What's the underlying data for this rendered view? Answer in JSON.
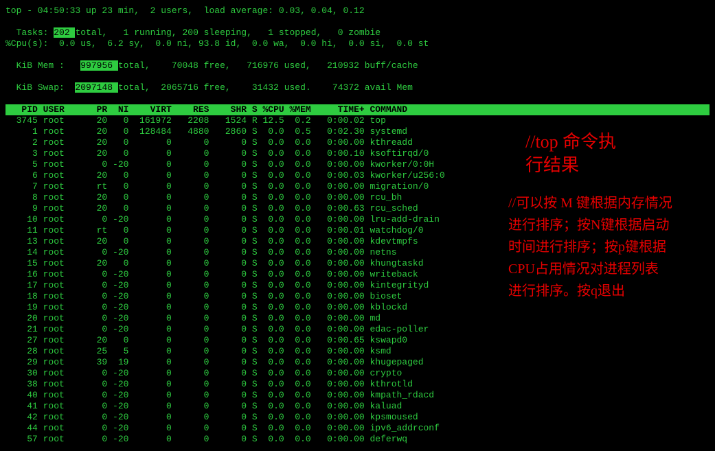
{
  "header": {
    "line1": "top - 04:50:33 up 23 min,  2 users,  load average: 0.03, 0.04, 0.12",
    "line2_pre": "Tasks: ",
    "line2_total": "202 ",
    "line2_post": "total,   1 running, 200 sleeping,   1 stopped,   0 zombie",
    "line3": "%Cpu(s):  0.0 us,  6.2 sy,  0.0 ni, 93.8 id,  0.0 wa,  0.0 hi,  0.0 si,  0.0 st",
    "line4_pre": "KiB Mem :   ",
    "line4_total": "997956 ",
    "line4_post": "total,    70048 free,   716976 used,   210932 buff/cache",
    "line5_pre": "KiB Swap:  ",
    "line5_total": "2097148 ",
    "line5_post": "total,  2065716 free,    31432 used.    74372 avail Mem"
  },
  "columns": "   PID USER      PR  NI    VIRT    RES    SHR S %CPU %MEM     TIME+ COMMAND                                       ",
  "processes": [
    {
      "row": "  3745 root      20   0  161972   2208   1524 R 12.5  0.2   0:00.02 top"
    },
    {
      "row": "     1 root      20   0  128484   4880   2860 S  0.0  0.5   0:02.30 systemd"
    },
    {
      "row": "     2 root      20   0       0      0      0 S  0.0  0.0   0:00.00 kthreadd"
    },
    {
      "row": "     3 root      20   0       0      0      0 S  0.0  0.0   0:00.10 ksoftirqd/0"
    },
    {
      "row": "     5 root       0 -20       0      0      0 S  0.0  0.0   0:00.00 kworker/0:0H"
    },
    {
      "row": "     6 root      20   0       0      0      0 S  0.0  0.0   0:00.03 kworker/u256:0"
    },
    {
      "row": "     7 root      rt   0       0      0      0 S  0.0  0.0   0:00.00 migration/0"
    },
    {
      "row": "     8 root      20   0       0      0      0 S  0.0  0.0   0:00.00 rcu_bh"
    },
    {
      "row": "     9 root      20   0       0      0      0 S  0.0  0.0   0:00.63 rcu_sched"
    },
    {
      "row": "    10 root       0 -20       0      0      0 S  0.0  0.0   0:00.00 lru-add-drain"
    },
    {
      "row": "    11 root      rt   0       0      0      0 S  0.0  0.0   0:00.01 watchdog/0"
    },
    {
      "row": "    13 root      20   0       0      0      0 S  0.0  0.0   0:00.00 kdevtmpfs"
    },
    {
      "row": "    14 root       0 -20       0      0      0 S  0.0  0.0   0:00.00 netns"
    },
    {
      "row": "    15 root      20   0       0      0      0 S  0.0  0.0   0:00.00 khungtaskd"
    },
    {
      "row": "    16 root       0 -20       0      0      0 S  0.0  0.0   0:00.00 writeback"
    },
    {
      "row": "    17 root       0 -20       0      0      0 S  0.0  0.0   0:00.00 kintegrityd"
    },
    {
      "row": "    18 root       0 -20       0      0      0 S  0.0  0.0   0:00.00 bioset"
    },
    {
      "row": "    19 root       0 -20       0      0      0 S  0.0  0.0   0:00.00 kblockd"
    },
    {
      "row": "    20 root       0 -20       0      0      0 S  0.0  0.0   0:00.00 md"
    },
    {
      "row": "    21 root       0 -20       0      0      0 S  0.0  0.0   0:00.00 edac-poller"
    },
    {
      "row": "    27 root      20   0       0      0      0 S  0.0  0.0   0:00.65 kswapd0"
    },
    {
      "row": "    28 root      25   5       0      0      0 S  0.0  0.0   0:00.00 ksmd"
    },
    {
      "row": "    29 root      39  19       0      0      0 S  0.0  0.0   0:00.00 khugepaged"
    },
    {
      "row": "    30 root       0 -20       0      0      0 S  0.0  0.0   0:00.00 crypto"
    },
    {
      "row": "    38 root       0 -20       0      0      0 S  0.0  0.0   0:00.00 kthrotld"
    },
    {
      "row": "    40 root       0 -20       0      0      0 S  0.0  0.0   0:00.00 kmpath_rdacd"
    },
    {
      "row": "    41 root       0 -20       0      0      0 S  0.0  0.0   0:00.00 kaluad"
    },
    {
      "row": "    42 root       0 -20       0      0      0 S  0.0  0.0   0:00.00 kpsmoused"
    },
    {
      "row": "    44 root       0 -20       0      0      0 S  0.0  0.0   0:00.00 ipv6_addrconf"
    },
    {
      "row": "    57 root       0 -20       0      0      0 S  0.0  0.0   0:00.00 deferwq"
    }
  ],
  "annotations": {
    "title_l1": "//top 命令执",
    "title_l2": "行结果",
    "desc_l1": "//可以按 M 键根据内存情况",
    "desc_l2": "进行排序；按N键根据启动",
    "desc_l3": "时间进行排序；按p键根据",
    "desc_l4": "CPU占用情况对进程列表",
    "desc_l5": "进行排序。按q退出"
  }
}
